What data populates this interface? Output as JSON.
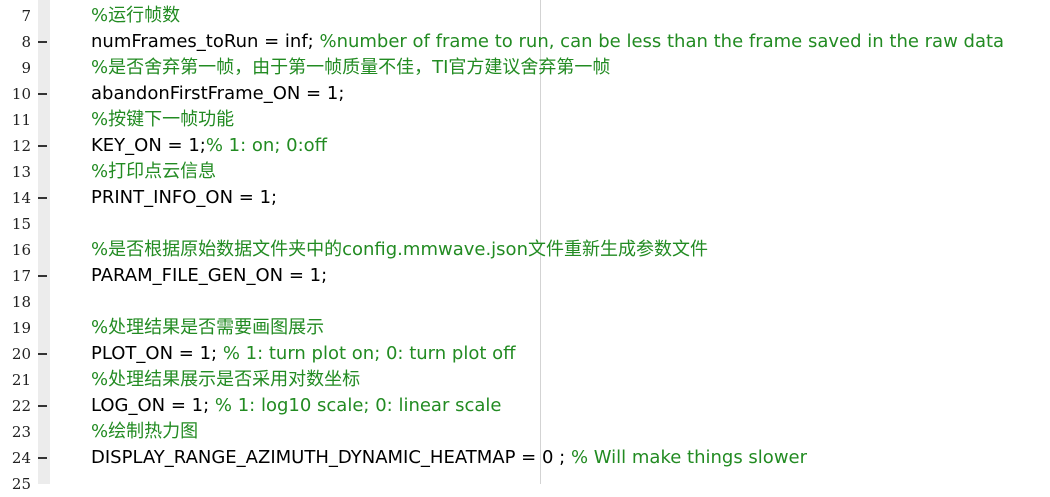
{
  "editor": {
    "lines": [
      {
        "num": "7",
        "dash": false,
        "code": "",
        "comment": "%运行帧数"
      },
      {
        "num": "8",
        "dash": true,
        "code": "numFrames_toRun = inf; ",
        "comment": "%number of frame to run, can be less than the frame saved in the raw data"
      },
      {
        "num": "9",
        "dash": false,
        "code": "",
        "comment": "%是否舍弃第一帧，由于第一帧质量不佳，TI官方建议舍弃第一帧"
      },
      {
        "num": "10",
        "dash": true,
        "code": "abandonFirstFrame_ON = 1;",
        "comment": ""
      },
      {
        "num": "11",
        "dash": false,
        "code": "",
        "comment": "%按键下一帧功能"
      },
      {
        "num": "12",
        "dash": true,
        "code": "KEY_ON = 1;",
        "comment": "% 1: on; 0:off"
      },
      {
        "num": "13",
        "dash": false,
        "code": "",
        "comment": "%打印点云信息"
      },
      {
        "num": "14",
        "dash": true,
        "code": "PRINT_INFO_ON = 1;",
        "comment": ""
      },
      {
        "num": "15",
        "dash": false,
        "code": "",
        "comment": ""
      },
      {
        "num": "16",
        "dash": false,
        "code": "",
        "comment": "%是否根据原始数据文件夹中的config.mmwave.json文件重新生成参数文件"
      },
      {
        "num": "17",
        "dash": true,
        "code": "PARAM_FILE_GEN_ON = 1;",
        "comment": ""
      },
      {
        "num": "18",
        "dash": false,
        "code": "",
        "comment": ""
      },
      {
        "num": "19",
        "dash": false,
        "code": "",
        "comment": "%处理结果是否需要画图展示"
      },
      {
        "num": "20",
        "dash": true,
        "code": "PLOT_ON = 1; ",
        "comment": "% 1: turn plot on; 0: turn plot off"
      },
      {
        "num": "21",
        "dash": false,
        "code": "",
        "comment": "%处理结果展示是否采用对数坐标"
      },
      {
        "num": "22",
        "dash": true,
        "code": "LOG_ON = 1; ",
        "comment": "% 1: log10 scale; 0: linear scale"
      },
      {
        "num": "23",
        "dash": false,
        "code": "",
        "comment": "%绘制热力图"
      },
      {
        "num": "24",
        "dash": true,
        "code": "DISPLAY_RANGE_AZIMUTH_DYNAMIC_HEATMAP = 0 ; ",
        "comment": "% Will make things slower"
      },
      {
        "num": "25",
        "dash": false,
        "code": "",
        "comment": ""
      }
    ]
  }
}
